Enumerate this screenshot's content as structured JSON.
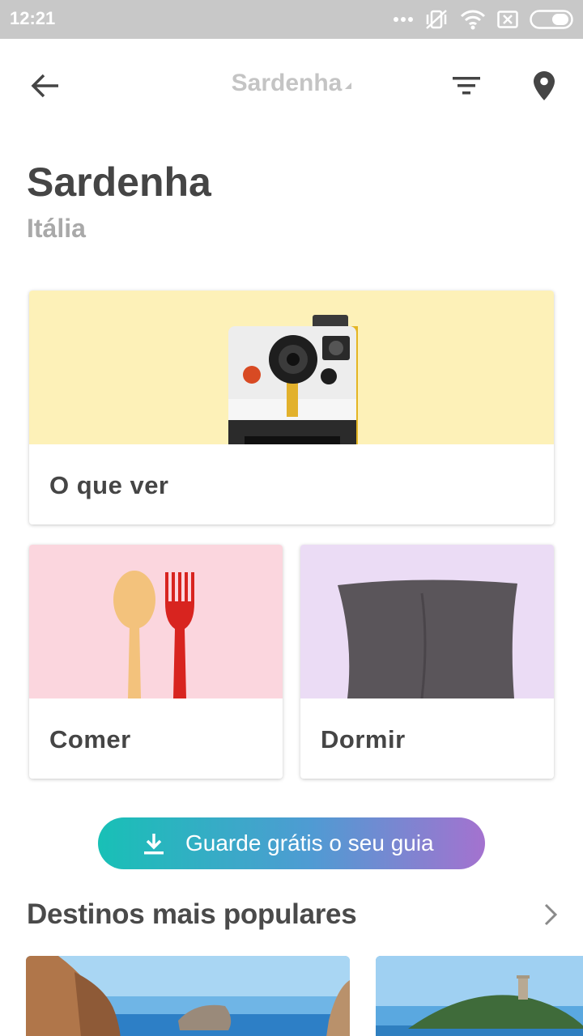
{
  "status_bar": {
    "time": "12:21",
    "icons": [
      "more-dots-icon",
      "vibrate-off-icon",
      "wifi-icon",
      "sim-none-icon",
      "battery-icon"
    ]
  },
  "app_bar": {
    "title": "Sardenha",
    "back_icon": "arrow-left-icon",
    "filter_icon": "filter-icon",
    "map_icon": "map-pin-icon"
  },
  "header": {
    "title": "Sardenha",
    "subtitle": "Itália"
  },
  "cards": {
    "see": {
      "label": "O que ver",
      "image": "polaroid-camera",
      "bg": "#fdf1b8"
    },
    "eat": {
      "label": "Comer",
      "image": "spoon-and-fork",
      "bg": "#fbd6de"
    },
    "sleep": {
      "label": "Dormir",
      "image": "pillow",
      "bg": "#ebdcf5"
    }
  },
  "cta": {
    "label": "Guarde grátis o seu guia",
    "icon": "download-icon"
  },
  "popular": {
    "title": "Destinos mais populares",
    "arrow_icon": "chevron-right-icon",
    "items": [
      "coastal-cliffs-photo",
      "island-tower-photo"
    ]
  },
  "colors": {
    "status_bar": "#c8c8c8",
    "cta_gradient": [
      "#18c0b6",
      "#a472cf"
    ],
    "text_dark": "#454545",
    "text_muted": "#a9a9a9"
  }
}
